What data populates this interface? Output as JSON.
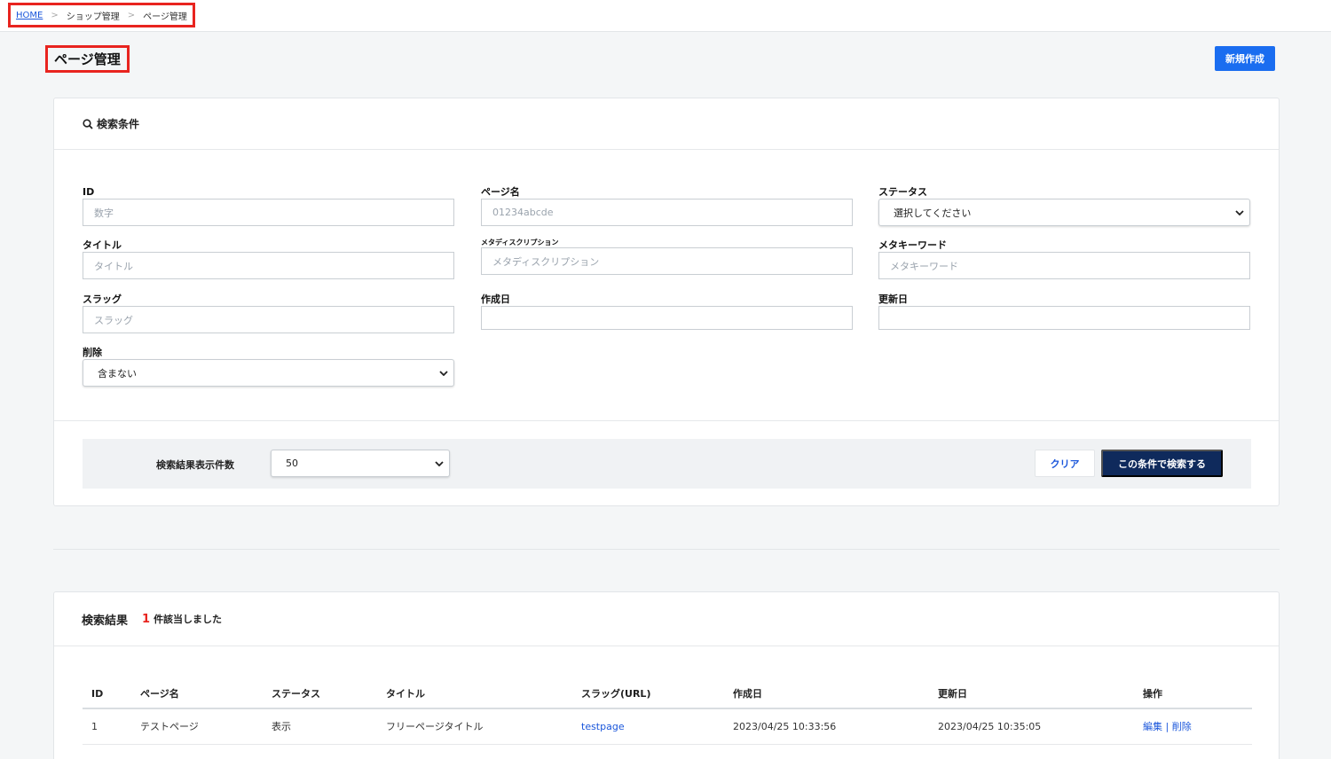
{
  "breadcrumb": {
    "home": "HOME",
    "sep": ">",
    "item1": "ショップ管理",
    "item2": "ページ管理"
  },
  "page_title": "ページ管理",
  "new_button": "新規作成",
  "search": {
    "header": "検索条件",
    "fields": {
      "id": {
        "label": "ID",
        "placeholder": "数字"
      },
      "page_name": {
        "label": "ページ名",
        "placeholder": "01234abcde"
      },
      "status": {
        "label": "ステータス",
        "value": "選択してください"
      },
      "title": {
        "label": "タイトル",
        "placeholder": "タイトル"
      },
      "meta_description": {
        "label": "メタディスクリプション",
        "placeholder": "メタディスクリプション"
      },
      "meta_keyword": {
        "label": "メタキーワード",
        "placeholder": "メタキーワード"
      },
      "slug": {
        "label": "スラッグ",
        "placeholder": "スラッグ"
      },
      "created": {
        "label": "作成日",
        "placeholder": ""
      },
      "updated": {
        "label": "更新日",
        "placeholder": ""
      },
      "deleted": {
        "label": "削除",
        "value": "含まない"
      }
    },
    "count_label": "検索結果表示件数",
    "count_value": "50",
    "clear_button": "クリア",
    "search_button": "この条件で検索する"
  },
  "results": {
    "title": "検索結果",
    "count": "1",
    "suffix": "件該当しました",
    "columns": [
      "ID",
      "ページ名",
      "ステータス",
      "タイトル",
      "スラッグ(URL)",
      "作成日",
      "更新日",
      "操作"
    ],
    "rows": [
      {
        "id": "1",
        "page_name": "テストページ",
        "status": "表示",
        "title": "フリーページタイトル",
        "slug": "testpage",
        "created": "2023/04/25 10:33:56",
        "updated": "2023/04/25 10:35:05",
        "edit": "編集",
        "op_sep": "|",
        "delete": "削除"
      }
    ]
  }
}
